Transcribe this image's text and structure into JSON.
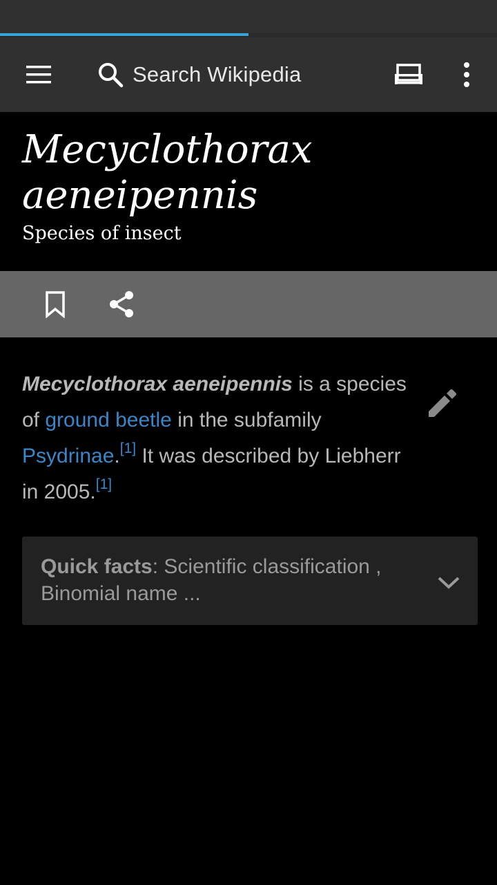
{
  "toolbar": {
    "search_placeholder": "Search Wikipedia",
    "icons": [
      "menu-icon",
      "search-icon",
      "tabs-icon",
      "overflow-menu-icon"
    ]
  },
  "progress": {
    "fraction": 0.5,
    "color": "#36a3d9"
  },
  "article": {
    "title_line1": "Mecyclothorax",
    "title_line2": "aeneipennis",
    "subtitle": "Species of insect"
  },
  "actions": {
    "icons": [
      "bookmark-icon",
      "share-icon"
    ]
  },
  "lead": {
    "name": "Mecyclothorax aeneipennis",
    "t1": " is a species of ",
    "link1": "ground beetle",
    "t2": " in the subfamily ",
    "link2": "Psydrinae",
    "t3": ".",
    "ref1": "[1]",
    "t4": " It was described by Liebherr in 2005.",
    "ref2": "[1]"
  },
  "quick_facts": {
    "label": "Quick facts",
    "summary": ": Scientific classification , Binomial name ..."
  },
  "colors": {
    "link": "#3a86c8",
    "toolbar": "#303030",
    "actionbar": "#666666",
    "panel": "#222222"
  }
}
